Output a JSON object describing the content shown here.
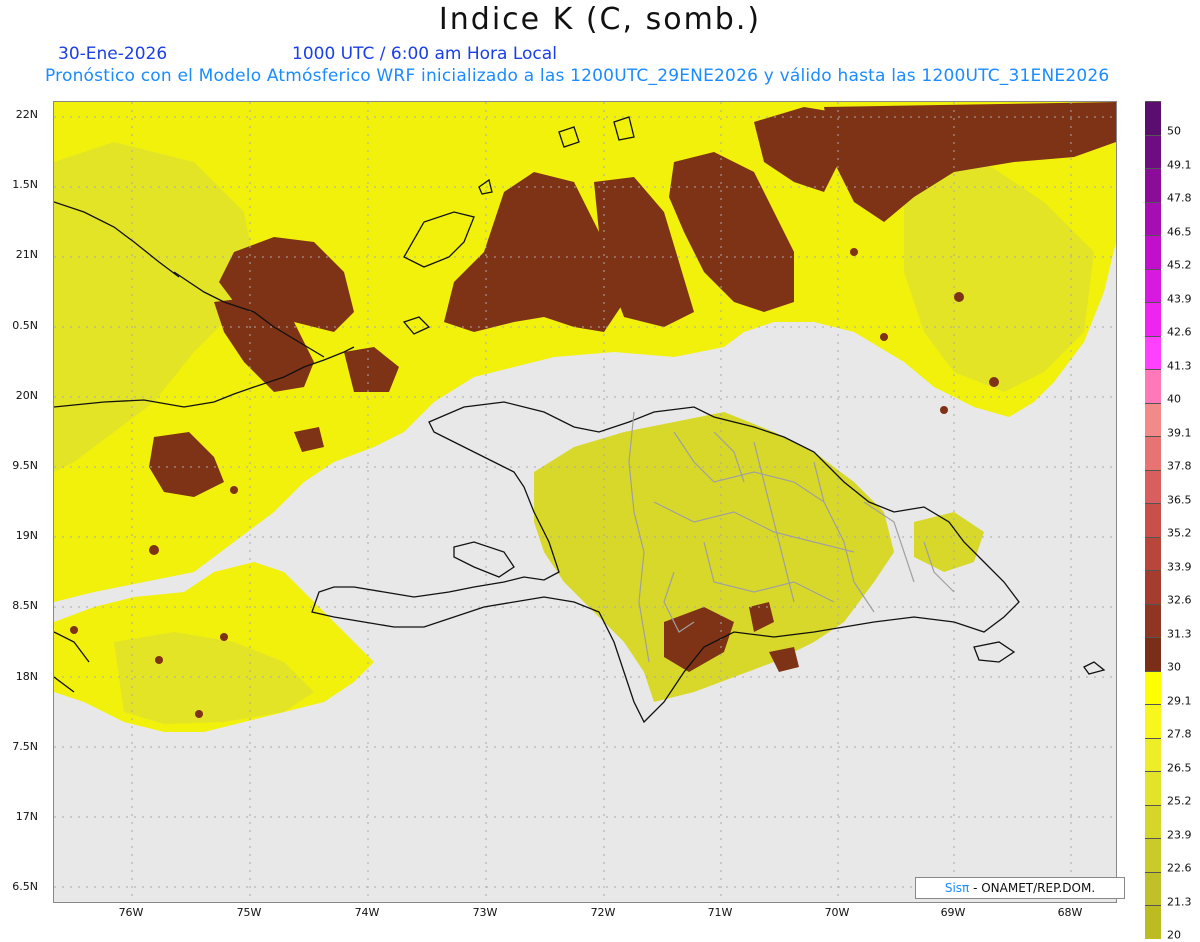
{
  "header": {
    "title": "Indice K (C, somb.)",
    "date": "30-Ene-2026",
    "time": "1000 UTC / 6:00 am Hora Local",
    "model_line": "Pronóstico con el Modelo Atmósferico WRF inicializado a las 1200UTC_29ENE2026 y válido hasta las  1200UTC_31ENE2026"
  },
  "map": {
    "lat_labels": [
      "22N",
      "1.5N",
      "21N",
      "0.5N",
      "20N",
      "9.5N",
      "19N",
      "8.5N",
      "18N",
      "7.5N",
      "17N",
      "6.5N"
    ],
    "lon_labels": [
      "76W",
      "75W",
      "74W",
      "73W",
      "72W",
      "71W",
      "70W",
      "69W",
      "68W"
    ],
    "background_color": "#e8e8e8"
  },
  "legend": {
    "labels": [
      "50",
      "49.1",
      "47.8",
      "46.5",
      "45.2",
      "43.9",
      "42.6",
      "41.3",
      "40",
      "39.1",
      "37.8",
      "36.5",
      "35.2",
      "33.9",
      "32.6",
      "31.3",
      "30",
      "29.1",
      "27.8",
      "26.5",
      "25.2",
      "23.9",
      "22.6",
      "21.3",
      "20"
    ],
    "colors": [
      "#5a0f6e",
      "#6e0d82",
      "#8a0c99",
      "#a60eb3",
      "#c20fcc",
      "#d81ae0",
      "#ee25f0",
      "#ff40ff",
      "#ff78b8",
      "#f28a8a",
      "#e87373",
      "#d95f5f",
      "#c94f4a",
      "#b8463a",
      "#a43d2e",
      "#8f3522",
      "#7a2e18",
      "#ffff00",
      "#f7f71e",
      "#eeee28",
      "#e3e32a",
      "#d6d62a",
      "#caca2a",
      "#c0c028",
      "#bcbc22"
    ]
  },
  "credit": {
    "brand": "Sisπ",
    "text": " - ONAMET/REP.DOM."
  }
}
